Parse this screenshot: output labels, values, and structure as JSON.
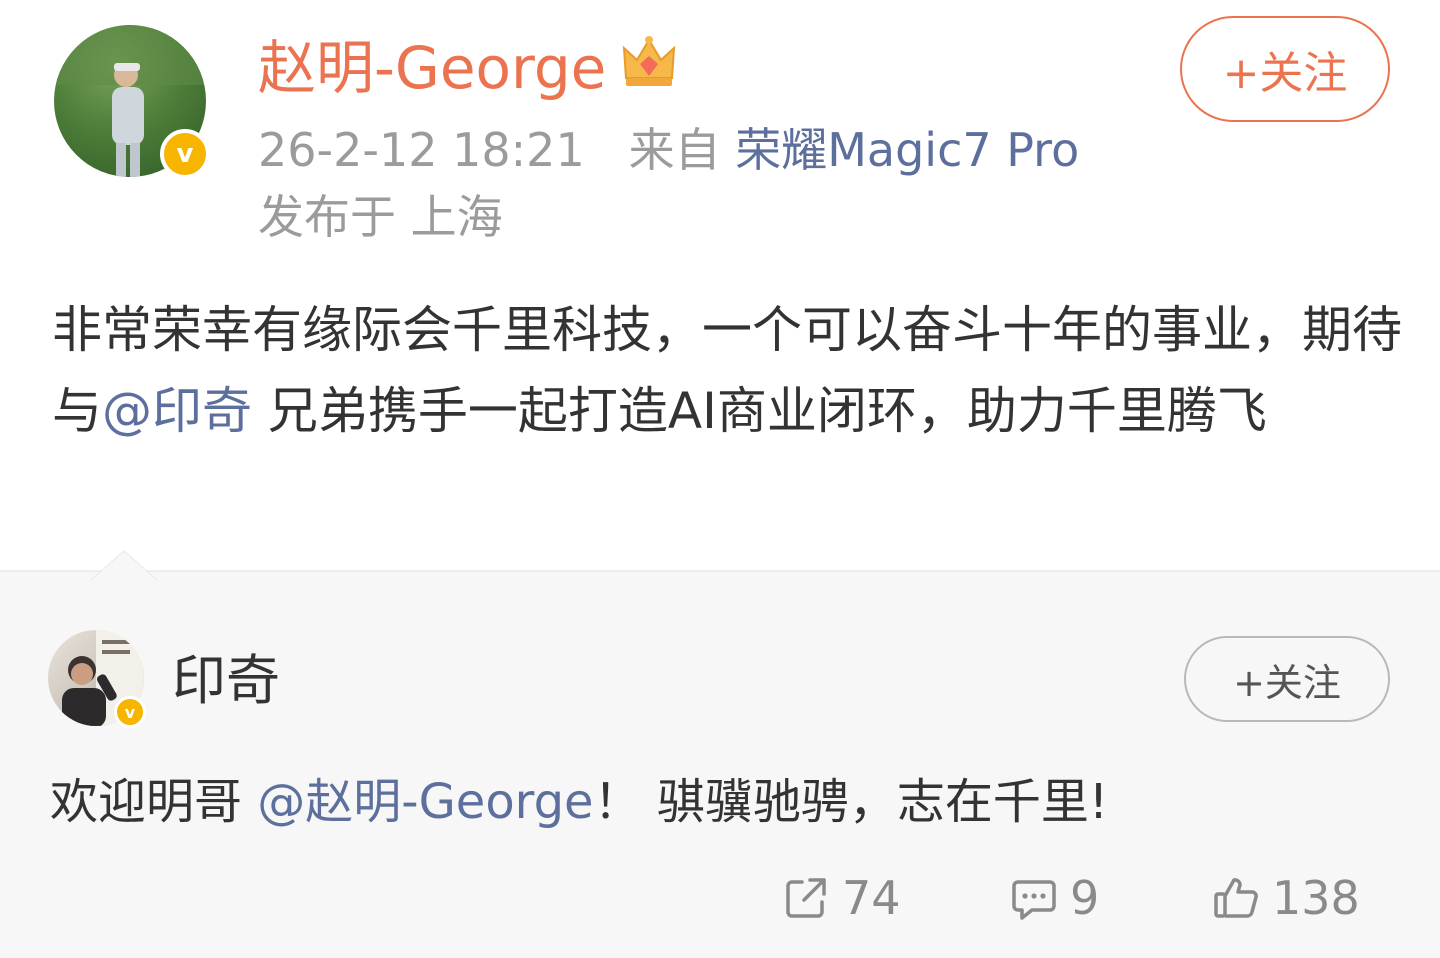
{
  "post": {
    "author": "赵明-George",
    "timestamp": "26-2-12 18:21",
    "source_prefix": "来自",
    "source_device": "荣耀Magic7 Pro",
    "location": "发布于 上海",
    "follow_label": "+关注",
    "text_part1": "非常荣幸有缘际会千里科技，一个可以奋斗十年的事业，期待与",
    "mention": "@印奇",
    "text_part2": " 兄弟携手一起打造AI商业闭环，助力千里腾飞",
    "badge": "v",
    "verified_color": "#f7b500",
    "accent_color": "#eb7350",
    "link_color": "#5d6f9d"
  },
  "repost": {
    "author": "印奇",
    "follow_label": "+关注",
    "text_prefix": "欢迎明哥 ",
    "mention": "@赵明-George",
    "text_suffix": "！ 骐骥驰骋，志在千里!",
    "badge": "v"
  },
  "actions": {
    "reposts": "74",
    "comments": "9",
    "likes": "138",
    "icons": [
      "share-icon",
      "comment-icon",
      "like-icon"
    ]
  }
}
